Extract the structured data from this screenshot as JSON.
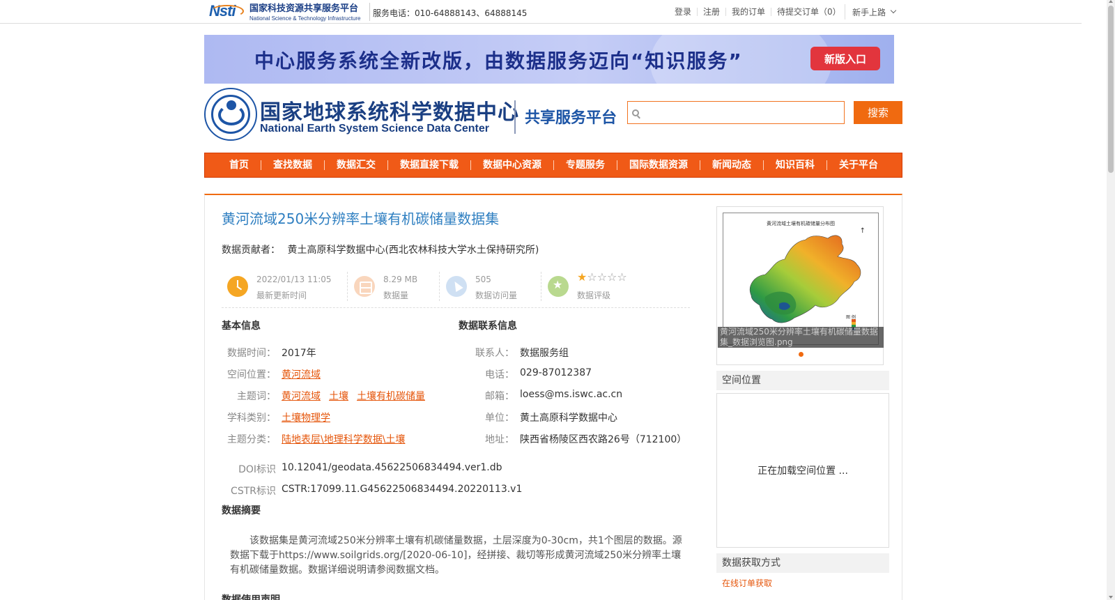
{
  "topbar": {
    "logo_cn": "国家科技资源共享服务平台",
    "logo_en": "National Science & Technology Infrastructure",
    "logo_mark": "Nsti",
    "service_phone": "服务电话：010-64888143、64888145",
    "links": [
      "登录",
      "注册",
      "我的订单",
      "待提交订单（0）"
    ],
    "guide_label": "新手上路"
  },
  "banner": {
    "text": "中心服务系统全新改版，由数据服务迈向“知识服务”",
    "button_label": "新版入口"
  },
  "header": {
    "center_name_cn": "国家地球系统科学数据中心",
    "center_name_en": "National Earth System Science Data Center",
    "platform_name": "共享服务平台",
    "search_placeholder": "",
    "search_button": "搜索"
  },
  "nav": {
    "items": [
      "首页",
      "查找数据",
      "数据汇交",
      "数据直接下载",
      "数据中心资源",
      "专题服务",
      "国际数据资源",
      "新闻动态",
      "知识百科",
      "关于平台"
    ]
  },
  "dataset": {
    "title": "黄河流域250米分辨率土壤有机碳储量数据集",
    "contributor_label": "数据贡献者：",
    "contributor": "黄土高原科学数据中心(西北农林科技大学水土保持研究所)",
    "stats": {
      "updated_value": "2022/01/13 11:05",
      "updated_label": "最新更新时间",
      "size_value": "8.29 MB",
      "size_label": "数据量",
      "visits_value": "505",
      "visits_label": "数据访问量",
      "rating_label": "数据评级",
      "rating": 1,
      "rating_max": 5
    },
    "basic_info": {
      "heading": "基本信息",
      "time_label": "数据时间：",
      "time_value": "2017年",
      "location_label": "空间位置：",
      "location_value": "黄河流域",
      "keywords_label": "主题词：",
      "keywords": [
        "黄河流域",
        "土壤",
        "土壤有机碳储量"
      ],
      "discipline_label": "学科类别：",
      "discipline_value": "土壤物理学",
      "category_label": "主题分类：",
      "category_value": "陆地表层\\地理科学数据\\土壤",
      "doi_label": "DOI标识",
      "doi_value": "10.12041/geodata.45622506834494.ver1.db",
      "cstr_label": "CSTR标识",
      "cstr_value": "CSTR:17099.11.G45622506834494.20220113.v1"
    },
    "contact_info": {
      "heading": "数据联系信息",
      "contact_label": "联系人：",
      "contact_value": "数据服务组",
      "phone_label": "电话：",
      "phone_value": "029-87012387",
      "email_label": "邮箱：",
      "email_value": "loess@ms.iswc.ac.cn",
      "unit_label": "单位：",
      "unit_value": "黄土高原科学数据中心",
      "address_label": "地址：",
      "address_value": "陕西省杨陵区西农路26号（712100）"
    },
    "abstract_heading": "数据摘要",
    "abstract_text": "该数据集是黄河流域250米分辨率土壤有机碳储量数据，土层深度为0-30cm，共1个图层的数据。源数据下载于https://www.soilgrids.org/[2020-06-10]，经拼接、裁切等形成黄河流域250米分辨率土壤有机碳储量数据。数据详细说明请参阅数据文档。",
    "usage_heading": "数据使用声明"
  },
  "sidebar": {
    "thumbnail_caption": "黄河流域250米分辨率土壤有机碳储量数据集_数据浏览图.png",
    "thumbnail_map_title": "黄河流域土壤有机碳储量分布图",
    "thumbnail_legend_title": "图 例",
    "spatial_heading": "空间位置",
    "spatial_loading": "正在加载空间位置 ...",
    "access_heading": "数据获取方式",
    "access_link": "在线订单获取"
  },
  "colors": {
    "accent": "#f06a10",
    "title_blue": "#2f7fc1",
    "link_orange": "#e5550a",
    "banner_button": "#e2353d"
  }
}
